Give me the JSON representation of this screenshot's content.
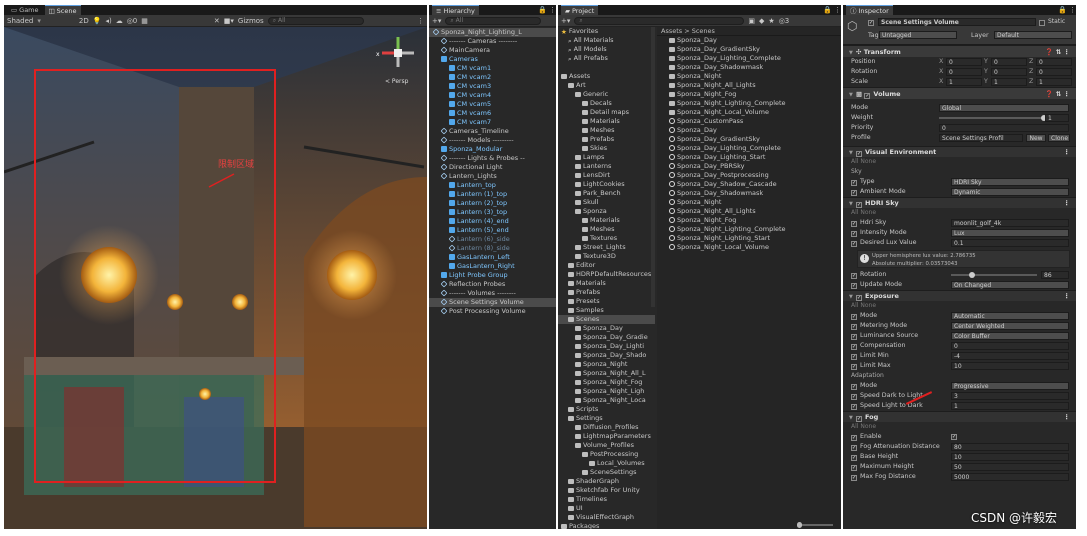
{
  "scene": {
    "tab_game": "Game",
    "tab_scene": "Scene",
    "shading": "Shaded",
    "mode_2d": "2D",
    "gizmos": "Gizmos",
    "search": "All",
    "persp": "< Persp",
    "annotation": "限制区域"
  },
  "hierarchy": {
    "tab": "Hierarchy",
    "search": "All",
    "items": [
      {
        "t": "Sponza_Night_Lighting_L",
        "c": "",
        "ind": 0,
        "sel": true
      },
      {
        "t": "------- Cameras --------",
        "c": "",
        "ind": 1
      },
      {
        "t": "MainCamera",
        "c": "",
        "ind": 1
      },
      {
        "t": "Cameras",
        "c": "cyan",
        "ind": 1
      },
      {
        "t": "CM vcam1",
        "c": "cyan",
        "ind": 2
      },
      {
        "t": "CM vcam2",
        "c": "cyan",
        "ind": 2
      },
      {
        "t": "CM vcam3",
        "c": "cyan",
        "ind": 2
      },
      {
        "t": "CM vcam4",
        "c": "cyan",
        "ind": 2
      },
      {
        "t": "CM vcam5",
        "c": "cyan",
        "ind": 2
      },
      {
        "t": "CM vcam6",
        "c": "cyan",
        "ind": 2
      },
      {
        "t": "CM vcam7",
        "c": "cyan",
        "ind": 2
      },
      {
        "t": "Cameras_Timeline",
        "c": "",
        "ind": 1
      },
      {
        "t": "------- Models ---------",
        "c": "",
        "ind": 1
      },
      {
        "t": "Sponza_Modular",
        "c": "cyan",
        "ind": 1
      },
      {
        "t": "------- Lights & Probes --",
        "c": "",
        "ind": 1
      },
      {
        "t": "Directional Light",
        "c": "",
        "ind": 1
      },
      {
        "t": "Lantern_Lights",
        "c": "",
        "ind": 1
      },
      {
        "t": "Lantern_top",
        "c": "cyan",
        "ind": 2
      },
      {
        "t": "Lantern (1)_top",
        "c": "cyan",
        "ind": 2
      },
      {
        "t": "Lantern (2)_top",
        "c": "cyan",
        "ind": 2
      },
      {
        "t": "Lantern (3)_top",
        "c": "cyan",
        "ind": 2
      },
      {
        "t": "Lantern (4)_end",
        "c": "cyan",
        "ind": 2
      },
      {
        "t": "Lantern (5)_end",
        "c": "cyan",
        "ind": 2
      },
      {
        "t": "Lantern (6)_side",
        "c": "dim",
        "ind": 2
      },
      {
        "t": "Lantern (8)_side",
        "c": "dim",
        "ind": 2
      },
      {
        "t": "GasLantern_Left",
        "c": "cyan",
        "ind": 2
      },
      {
        "t": "GasLantern_Right",
        "c": "cyan",
        "ind": 2
      },
      {
        "t": "Light Probe Group",
        "c": "cyan",
        "ind": 1
      },
      {
        "t": "Reflection Probes",
        "c": "",
        "ind": 1
      },
      {
        "t": "------- Volumes --------",
        "c": "",
        "ind": 1
      },
      {
        "t": "Scene Settings Volume",
        "c": "",
        "ind": 1,
        "sel": true
      },
      {
        "t": "Post Processing Volume",
        "c": "",
        "ind": 1
      }
    ]
  },
  "project": {
    "tab": "Project",
    "breadcrumb": "Assets > Scenes",
    "count": "3",
    "tree": [
      {
        "t": "Favorites",
        "i": "star",
        "ind": 0
      },
      {
        "t": "All Materials",
        "i": "q",
        "ind": 1
      },
      {
        "t": "All Models",
        "i": "q",
        "ind": 1
      },
      {
        "t": "All Prefabs",
        "i": "q",
        "ind": 1
      },
      {
        "t": "",
        "i": "",
        "ind": 0
      },
      {
        "t": "Assets",
        "i": "fd",
        "ind": 0
      },
      {
        "t": "Art",
        "i": "fd",
        "ind": 1
      },
      {
        "t": "Generic",
        "i": "fd",
        "ind": 2
      },
      {
        "t": "Decals",
        "i": "fd",
        "ind": 3
      },
      {
        "t": "Detail maps",
        "i": "fd",
        "ind": 3
      },
      {
        "t": "Materials",
        "i": "fd",
        "ind": 3
      },
      {
        "t": "Meshes",
        "i": "fd",
        "ind": 3
      },
      {
        "t": "Prefabs",
        "i": "fd",
        "ind": 3
      },
      {
        "t": "Skies",
        "i": "fd",
        "ind": 3
      },
      {
        "t": "Lamps",
        "i": "fd",
        "ind": 2
      },
      {
        "t": "Lanterns",
        "i": "fd",
        "ind": 2
      },
      {
        "t": "LensDirt",
        "i": "fd",
        "ind": 2
      },
      {
        "t": "LightCookies",
        "i": "fd",
        "ind": 2
      },
      {
        "t": "Park_Bench",
        "i": "fd",
        "ind": 2
      },
      {
        "t": "Skull",
        "i": "fd",
        "ind": 2
      },
      {
        "t": "Sponza",
        "i": "fd",
        "ind": 2
      },
      {
        "t": "Materials",
        "i": "fd",
        "ind": 3
      },
      {
        "t": "Meshes",
        "i": "fd",
        "ind": 3
      },
      {
        "t": "Textures",
        "i": "fd",
        "ind": 3
      },
      {
        "t": "Street_Lights",
        "i": "fd",
        "ind": 2
      },
      {
        "t": "Texture3D",
        "i": "fd",
        "ind": 2
      },
      {
        "t": "Editor",
        "i": "fd",
        "ind": 1
      },
      {
        "t": "HDRPDefaultResources",
        "i": "fd",
        "ind": 1
      },
      {
        "t": "Materials",
        "i": "fd",
        "ind": 1
      },
      {
        "t": "Prefabs",
        "i": "fd",
        "ind": 1
      },
      {
        "t": "Presets",
        "i": "fd",
        "ind": 1
      },
      {
        "t": "Samples",
        "i": "fd",
        "ind": 1
      },
      {
        "t": "Scenes",
        "i": "fd",
        "ind": 1,
        "sel": true
      },
      {
        "t": "Sponza_Day",
        "i": "fd",
        "ind": 2
      },
      {
        "t": "Sponza_Day_Gradie",
        "i": "fd",
        "ind": 2
      },
      {
        "t": "Sponza_Day_Lighti",
        "i": "fd",
        "ind": 2
      },
      {
        "t": "Sponza_Day_Shado",
        "i": "fd",
        "ind": 2
      },
      {
        "t": "Sponza_Night",
        "i": "fd",
        "ind": 2
      },
      {
        "t": "Sponza_Night_All_L",
        "i": "fd",
        "ind": 2
      },
      {
        "t": "Sponza_Night_Fog",
        "i": "fd",
        "ind": 2
      },
      {
        "t": "Sponza_Night_Ligh",
        "i": "fd",
        "ind": 2
      },
      {
        "t": "Sponza_Night_Loca",
        "i": "fd",
        "ind": 2
      },
      {
        "t": "Scripts",
        "i": "fd",
        "ind": 1
      },
      {
        "t": "Settings",
        "i": "fd",
        "ind": 1
      },
      {
        "t": "Diffusion_Profiles",
        "i": "fd",
        "ind": 2
      },
      {
        "t": "LightmapParameters",
        "i": "fd",
        "ind": 2
      },
      {
        "t": "Volume_Profiles",
        "i": "fd",
        "ind": 2
      },
      {
        "t": "PostProcessing",
        "i": "fd",
        "ind": 3
      },
      {
        "t": "Local_Volumes",
        "i": "fd",
        "ind": 4
      },
      {
        "t": "SceneSettings",
        "i": "fd",
        "ind": 3
      },
      {
        "t": "ShaderGraph",
        "i": "fd",
        "ind": 1
      },
      {
        "t": "Sketchfab For Unity",
        "i": "fd",
        "ind": 1
      },
      {
        "t": "Timelines",
        "i": "fd",
        "ind": 1
      },
      {
        "t": "UI",
        "i": "fd",
        "ind": 1
      },
      {
        "t": "VisualEffectGraph",
        "i": "fd",
        "ind": 1
      },
      {
        "t": "Packages",
        "i": "fd",
        "ind": 0
      }
    ],
    "files": [
      {
        "t": "Sponza_Day",
        "i": "fd"
      },
      {
        "t": "Sponza_Day_GradientSky",
        "i": "fd"
      },
      {
        "t": "Sponza_Day_Lighting_Complete",
        "i": "fd"
      },
      {
        "t": "Sponza_Day_Shadowmask",
        "i": "fd"
      },
      {
        "t": "Sponza_Night",
        "i": "fd"
      },
      {
        "t": "Sponza_Night_All_Lights",
        "i": "fd"
      },
      {
        "t": "Sponza_Night_Fog",
        "i": "fd"
      },
      {
        "t": "Sponza_Night_Lighting_Complete",
        "i": "fd"
      },
      {
        "t": "Sponza_Night_Local_Volume",
        "i": "fd"
      },
      {
        "t": "Sponza_CustomPass",
        "i": "sc"
      },
      {
        "t": "Sponza_Day",
        "i": "sc"
      },
      {
        "t": "Sponza_Day_GradientSky",
        "i": "sc"
      },
      {
        "t": "Sponza_Day_Lighting_Complete",
        "i": "sc"
      },
      {
        "t": "Sponza_Day_Lighting_Start",
        "i": "sc"
      },
      {
        "t": "Sponza_Day_PBRSky",
        "i": "sc"
      },
      {
        "t": "Sponza_Day_Postprocessing",
        "i": "sc"
      },
      {
        "t": "Sponza_Day_Shadow_Cascade",
        "i": "sc"
      },
      {
        "t": "Sponza_Day_Shadowmask",
        "i": "sc"
      },
      {
        "t": "Sponza_Night",
        "i": "sc"
      },
      {
        "t": "Sponza_Night_All_Lights",
        "i": "sc"
      },
      {
        "t": "Sponza_Night_Fog",
        "i": "sc"
      },
      {
        "t": "Sponza_Night_Lighting_Complete",
        "i": "sc"
      },
      {
        "t": "Sponza_Night_Lighting_Start",
        "i": "sc"
      },
      {
        "t": "Sponza_Night_Local_Volume",
        "i": "sc"
      }
    ]
  },
  "inspector": {
    "tab": "Inspector",
    "object": "Scene Settings Volume",
    "static": "Static",
    "tag_label": "Tag",
    "tag": "Untagged",
    "layer_label": "Layer",
    "layer": "Default",
    "transform": "Transform",
    "pos": "Position",
    "rot": "Rotation",
    "scl": "Scale",
    "pos_v": [
      "0",
      "0",
      "0"
    ],
    "rot_v": [
      "0",
      "0",
      "0"
    ],
    "scl_v": [
      "1",
      "1",
      "1"
    ],
    "volume": "Volume",
    "mode_l": "Mode",
    "mode": "Global",
    "weight_l": "Weight",
    "weight": "1",
    "weight_frac": 1,
    "prio_l": "Priority",
    "prio": "0",
    "profile_l": "Profile",
    "profile": "Scene Settings Profil",
    "new": "New",
    "clone": "Clone",
    "visenv": "Visual Environment",
    "all": "All",
    "none": "None",
    "sky": "Sky",
    "type_l": "Type",
    "type": "HDRI Sky",
    "amb_l": "Ambient Mode",
    "amb": "Dynamic",
    "hdri": "HDRI Sky",
    "hdrisky_l": "Hdri Sky",
    "hdrisky": "moonlit_golf_4k",
    "int_l": "Intensity Mode",
    "int": "Lux",
    "lux_l": "Desired Lux Value",
    "lux": "0.1",
    "info1": "Upper hemisphere lux value: 2.786735",
    "info2": "Absolute multiplier: 0.03573043",
    "rotation_l": "Rotation",
    "rotation": "86",
    "rotation_frac": 0.24,
    "upd_l": "Update Mode",
    "upd": "On Changed",
    "exposure": "Exposure",
    "emode_l": "Mode",
    "emode": "Automatic",
    "meter_l": "Metering Mode",
    "meter": "Center Weighted",
    "lum_l": "Luminance Source",
    "lum": "Color Buffer",
    "comp_l": "Compensation",
    "comp": "0",
    "lmin_l": "Limit Min",
    "lmin": "-4",
    "lmax_l": "Limit Max",
    "lmax": "10",
    "adapt": "Adaptation",
    "amode_l": "Mode",
    "amode": "Progressive",
    "sdl_l": "Speed Dark to Light",
    "sdl": "3",
    "sld_l": "Speed Light to Dark",
    "sld": "1",
    "fog": "Fog",
    "en_l": "Enable",
    "fad_l": "Fog Attenuation Distance",
    "fad": "80",
    "bh_l": "Base Height",
    "bh": "10",
    "mh_l": "Maximum Height",
    "mh": "50",
    "mfd_l": "Max Fog Distance",
    "mfd": "5000"
  },
  "watermark": "CSDN @许毅宏"
}
